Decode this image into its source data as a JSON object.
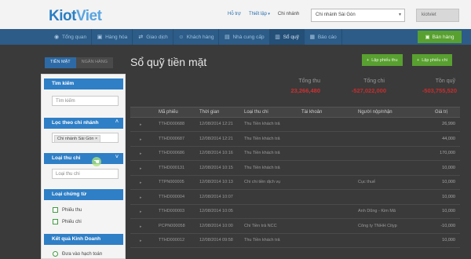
{
  "header": {
    "logo_part1": "Kiot",
    "logo_part2": "Viet",
    "help": "Hỗ trợ",
    "settings": "Thiết lập",
    "branch_label": "Chi nhánh",
    "branch_value": "Chi nhánh Sài Gòn",
    "user": "kiotviet"
  },
  "nav": {
    "items": [
      "Tổng quan",
      "Hàng hóa",
      "Giao dịch",
      "Khách hàng",
      "Nhà cung cấp",
      "Sổ quỹ",
      "Báo cáo"
    ],
    "active_index": 5,
    "sell_button": "Bán hàng"
  },
  "tabs": {
    "cash": "TIỀN MẶT",
    "bank": "NGÂN HÀNG"
  },
  "sidebar": {
    "search_title": "Tìm kiếm",
    "search_placeholder": "Tìm kiếm",
    "branch_filter_title": "Lọc theo chi nhánh",
    "branch_chip": "Chi nhánh Sài Gòn ×",
    "expense_type_title": "Loại thu chi",
    "expense_type_placeholder": "Loại thu chi",
    "voucher_type_title": "Loại chứng từ",
    "receipt_option": "Phiếu thu",
    "payment_option": "Phiếu chi",
    "business_result_title": "Kết quả Kinh Doanh",
    "accounting_option": "Đưa vào hạch toán"
  },
  "page": {
    "title": "Sổ quỹ tiền mặt",
    "add_receipt": "Lập phiếu thu",
    "add_payment": "Lập phiếu chi"
  },
  "totals": {
    "income_label": "Tổng thu",
    "income_value": "23,266,480",
    "expense_label": "Tổng chi",
    "expense_value": "-527,022,000",
    "balance_label": "Tồn quỹ",
    "balance_value": "-503,755,520"
  },
  "table": {
    "headers": [
      "Mã phiếu",
      "Thời gian",
      "Loại thu chi",
      "Tài khoản",
      "Người nộp/nhận",
      "Giá trị"
    ],
    "rows": [
      [
        "TTHD000688",
        "12/08/2014 12:21",
        "Thu Tiền khách trả",
        "",
        "",
        "26,990"
      ],
      [
        "TTHD000687",
        "12/08/2014 12:21",
        "Thu Tiền khách trả",
        "",
        "",
        "44,000"
      ],
      [
        "TTHD000686",
        "12/08/2014 10:16",
        "Thu Tiền khách trả",
        "",
        "",
        "170,000"
      ],
      [
        "TTHD000131",
        "12/08/2014 10:15",
        "Thu Tiền khách trả",
        "",
        "",
        "10,000"
      ],
      [
        "TTPN000005",
        "12/08/2014 10:13",
        "Chi chi tiền dịch vụ",
        "",
        "Cục thuế",
        "10,000"
      ],
      [
        "TTHD000004",
        "12/08/2014 10:07",
        "",
        "",
        "",
        "10,000"
      ],
      [
        "TTHD000003",
        "12/08/2014 10:05",
        "",
        "",
        "Anh Dũng - Kim Mã",
        "10,000"
      ],
      [
        "PCPN000058",
        "12/08/2014 10:00",
        "Chi Tiền trả NCC",
        "",
        "Công ty TNHH Cityp",
        "-10,000"
      ],
      [
        "TTHD000012",
        "12/08/2014 09:58",
        "Thu Tiền khách trả",
        "",
        "",
        "10,000"
      ]
    ]
  },
  "colors": {
    "accent_blue": "#2f7fc6",
    "nav_blue": "#2c5c87",
    "green_button": "#58a030",
    "negative_red": "#c92d2d",
    "income_red": "#d03030"
  }
}
